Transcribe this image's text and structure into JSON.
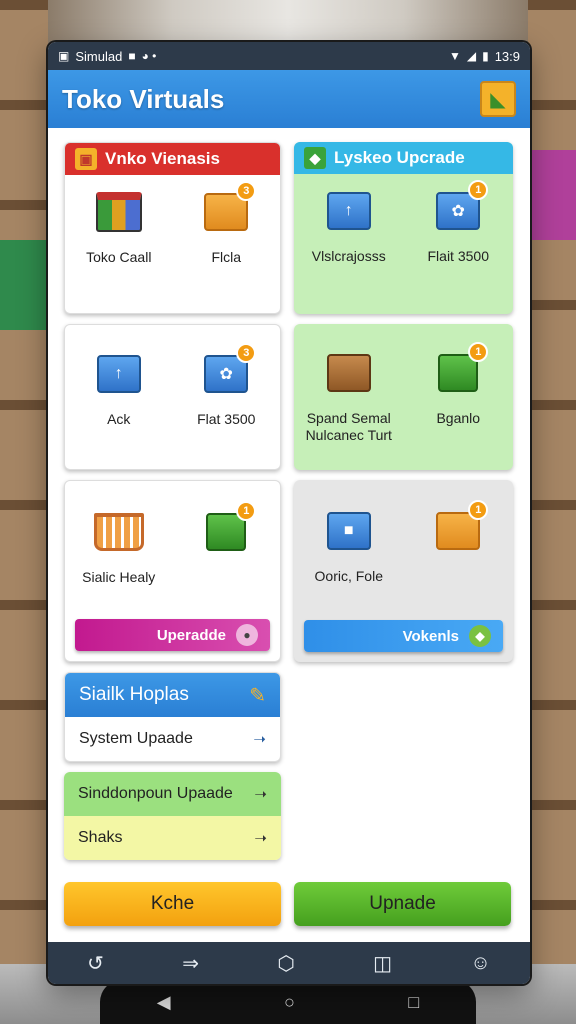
{
  "status": {
    "carrier": "Simulad",
    "time": "13:9"
  },
  "app": {
    "title": "Toko Virtuals"
  },
  "cards": {
    "c1": {
      "header": "Vnko Vienasis",
      "items": [
        "Toko Caall",
        "Flcla"
      ],
      "badges": [
        "3"
      ]
    },
    "c2": {
      "header": "Lyskeo Upcrade",
      "items": [
        "Vlslcrajosss",
        "Flait 3500"
      ],
      "badges": [
        "1"
      ]
    },
    "c3": {
      "items": [
        "Ack",
        "Flat 3500"
      ],
      "badges": [
        "3"
      ]
    },
    "c4": {
      "items": [
        "Spand Semal Nulcanec Turt",
        "Bganlo"
      ],
      "badges": [
        "1"
      ]
    },
    "c5": {
      "items": [
        "Sialic Healy"
      ],
      "badges": [
        "1"
      ],
      "button": "Uperadde"
    },
    "c6": {
      "items": [
        "Ooric, Fole"
      ],
      "badges": [
        "1"
      ],
      "button": "Vokenls"
    }
  },
  "list1": {
    "header": "Siailk Hoplas",
    "rows": [
      "System Upaade"
    ]
  },
  "list2": {
    "rows": [
      "Sinddonpoun Upaade",
      "Shaks"
    ]
  },
  "actions": {
    "left": "Kche",
    "right": "Upnade"
  },
  "colors": {
    "red_header": "#d9302c",
    "cyan_header": "#35b8e6",
    "green_panel": "#c6efb8",
    "grey_panel": "#e6e6e6",
    "magenta_button": "#c2198f",
    "blue_button": "#2f8fe8",
    "orange_action": "#f6b31b",
    "green_action": "#58b62a"
  }
}
